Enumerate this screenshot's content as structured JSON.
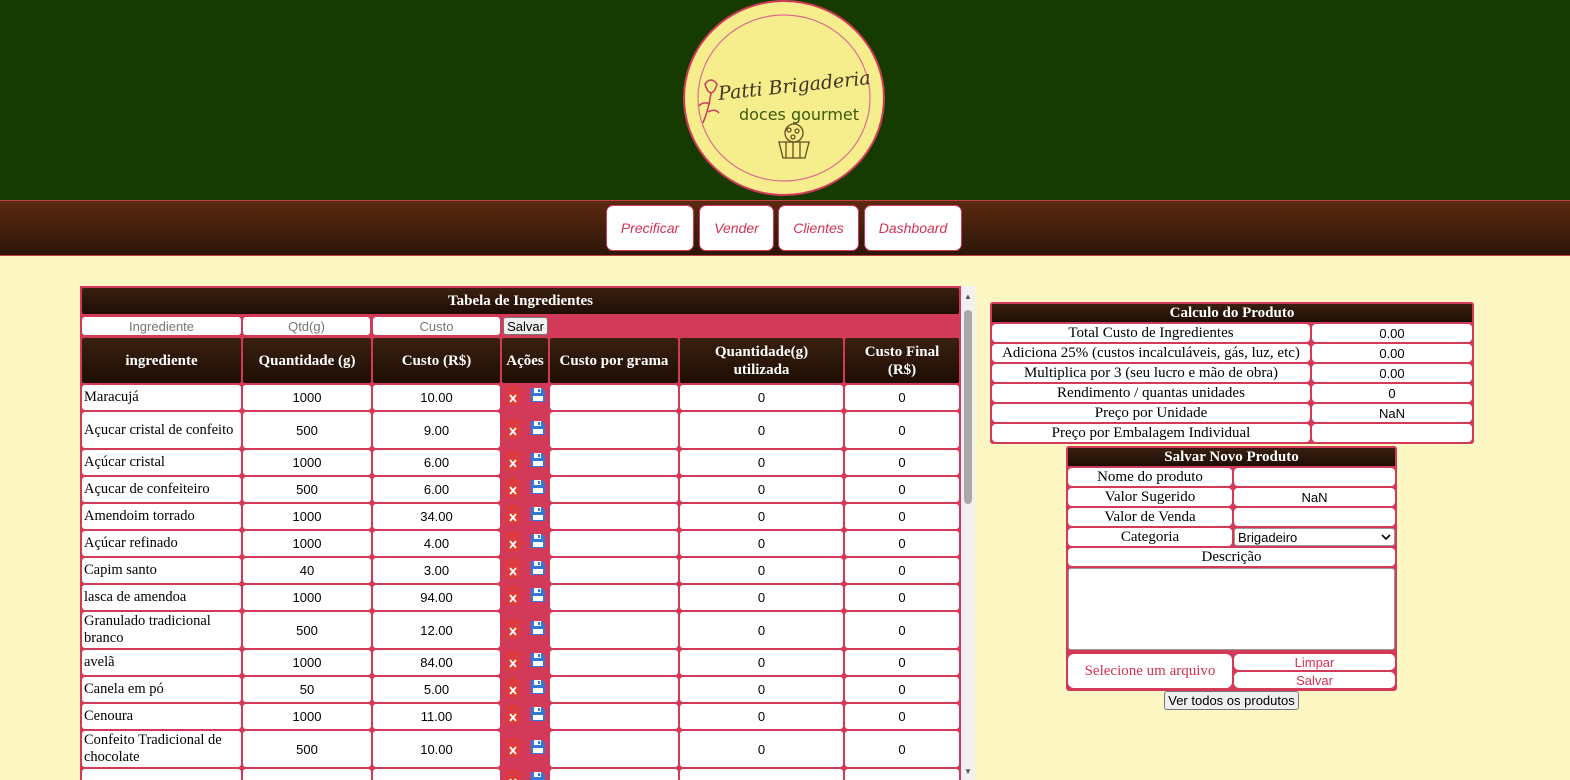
{
  "logo": {
    "line1": "Patti Brigaderia",
    "line2": "doces gourmet"
  },
  "nav": [
    "Precificar",
    "Vender",
    "Clientes",
    "Dashboard"
  ],
  "ingredients": {
    "title": "Tabela de Ingredientes",
    "add_placeholders": {
      "name": "Ingrediente",
      "qty": "Qtd(g)",
      "cost": "Custo"
    },
    "add_button": "Salvar",
    "headers": [
      "ingrediente",
      "Quantidade (g)",
      "Custo (R$)",
      "Ações",
      "Custo por grama",
      "Quantidade(g) utilizada",
      "Custo Final (R$)"
    ],
    "rows": [
      {
        "name": "Maracujá",
        "qty": "1000",
        "cost": "10.00",
        "cpg": "",
        "used": "0",
        "final": "0"
      },
      {
        "name": "Açucar cristal de confeito",
        "qty": "500",
        "cost": "9.00",
        "cpg": "",
        "used": "0",
        "final": "0"
      },
      {
        "name": "Açúcar cristal",
        "qty": "1000",
        "cost": "6.00",
        "cpg": "",
        "used": "0",
        "final": "0"
      },
      {
        "name": "Açucar de confeiteiro",
        "qty": "500",
        "cost": "6.00",
        "cpg": "",
        "used": "0",
        "final": "0"
      },
      {
        "name": "Amendoim torrado",
        "qty": "1000",
        "cost": "34.00",
        "cpg": "",
        "used": "0",
        "final": "0"
      },
      {
        "name": "Açúcar refinado",
        "qty": "1000",
        "cost": "4.00",
        "cpg": "",
        "used": "0",
        "final": "0"
      },
      {
        "name": "Capim santo",
        "qty": "40",
        "cost": "3.00",
        "cpg": "",
        "used": "0",
        "final": "0"
      },
      {
        "name": "lasca de amendoa",
        "qty": "1000",
        "cost": "94.00",
        "cpg": "",
        "used": "0",
        "final": "0"
      },
      {
        "name": "Granulado tradicional branco",
        "qty": "500",
        "cost": "12.00",
        "cpg": "",
        "used": "0",
        "final": "0"
      },
      {
        "name": "avelã",
        "qty": "1000",
        "cost": "84.00",
        "cpg": "",
        "used": "0",
        "final": "0"
      },
      {
        "name": "Canela em pó",
        "qty": "50",
        "cost": "5.00",
        "cpg": "",
        "used": "0",
        "final": "0"
      },
      {
        "name": "Cenoura",
        "qty": "1000",
        "cost": "11.00",
        "cpg": "",
        "used": "0",
        "final": "0"
      },
      {
        "name": "Confeito Tradicional de chocolate",
        "qty": "500",
        "cost": "10.00",
        "cpg": "",
        "used": "0",
        "final": "0"
      }
    ]
  },
  "calc": {
    "title": "Calculo do Produto",
    "rows": [
      {
        "label": "Total Custo de Ingredientes",
        "value": "0.00"
      },
      {
        "label": "Adiciona 25% (custos incalculáveis, gás, luz, etc)",
        "value": "0.00"
      },
      {
        "label": "Multiplica por 3 (seu lucro e mão de obra)",
        "value": "0.00"
      },
      {
        "label": "Rendimento / quantas unidades",
        "value": "0"
      },
      {
        "label": "Preço por Unidade",
        "value": "NaN"
      },
      {
        "label": "Preço por Embalagem Individual",
        "value": ""
      }
    ]
  },
  "save_product": {
    "title": "Salvar Novo Produto",
    "name_label": "Nome do produto",
    "suggested_label": "Valor Sugerido",
    "suggested_value": "NaN",
    "sale_label": "Valor de Venda",
    "category_label": "Categoria",
    "category_value": "Brigadeiro",
    "description_label": "Descrição",
    "file_button": "Selecione um arquivo",
    "clear_button": "Limpar",
    "save_button": "Salvar"
  },
  "view_all_button": "Ver todos os produtos",
  "colors": {
    "header_green": "#153a02",
    "accent": "#d33a5a",
    "background": "#fdf7c3",
    "dark_brown": "#2e160a",
    "logo_yellow": "#f6ee8c"
  }
}
